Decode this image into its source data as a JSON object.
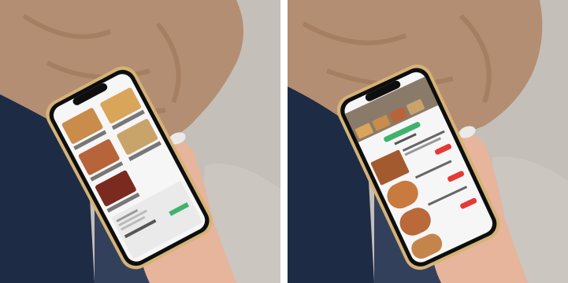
{
  "colors": {
    "background_white": "#ffffff",
    "grey_floor": "#bdb8b3",
    "sweater_tan": "#b48e72",
    "jeans_navy": "#1e2b44",
    "skin": "#e6b59b",
    "phone_gold": "#d5b377",
    "phone_bezel": "#0e0e0e",
    "screen_white": "#f6f6f6",
    "accent_green": "#3db36b",
    "accent_red": "#e53935"
  },
  "left_phone": {
    "screen": "catalog-grid-with-food-photos"
  },
  "right_phone": {
    "screen": "order-list-with-food-photos"
  }
}
